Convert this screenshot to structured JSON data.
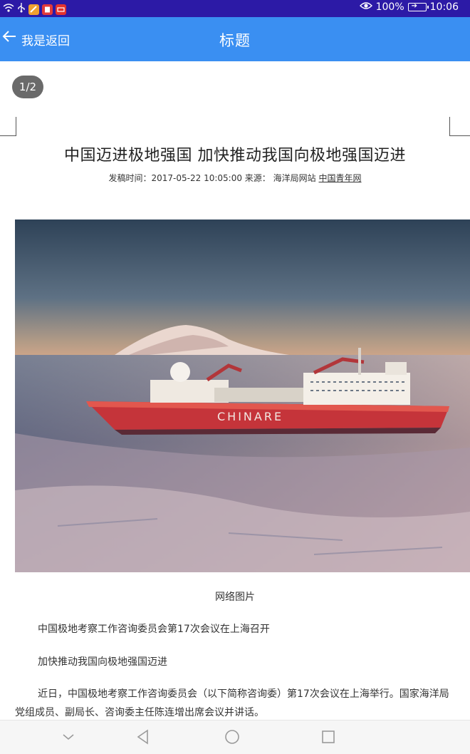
{
  "status_bar": {
    "left_icons": [
      "wifi-icon",
      "usb-icon",
      "app-icon-orange",
      "app-icon-red-book",
      "app-icon-red-news"
    ],
    "battery_percent": "100%",
    "time": "10:06",
    "colors": {
      "background": "#2c1aa6"
    }
  },
  "header": {
    "back_label": "我是返回",
    "title": "标题",
    "colors": {
      "background": "#3a8ff2"
    }
  },
  "content": {
    "page_indicator": "1/2",
    "article_title": "中国迈进极地强国  加快推动我国向极地强国迈进",
    "meta": {
      "prefix": "发稿时间：",
      "datetime": "2017-05-22 10:05:00",
      "source_label": "来源：",
      "source": "海洋局网站",
      "source_link": "中国青年网"
    },
    "image_caption": "网络图片",
    "ship_name": "CHINARE",
    "paragraphs": [
      "中国极地考察工作咨询委员会第17次会议在上海召开",
      "加快推动我国向极地强国迈进",
      "近日，中国极地考察工作咨询委员会（以下简称咨询委）第17次会议在上海举行。国家海洋局党组成员、副局长、咨询委主任陈连增出席会议并讲话。"
    ]
  },
  "nav_bar": {
    "buttons": [
      "hide-keyboard-icon",
      "back-triangle-icon",
      "home-circle-icon",
      "recents-square-icon"
    ]
  }
}
